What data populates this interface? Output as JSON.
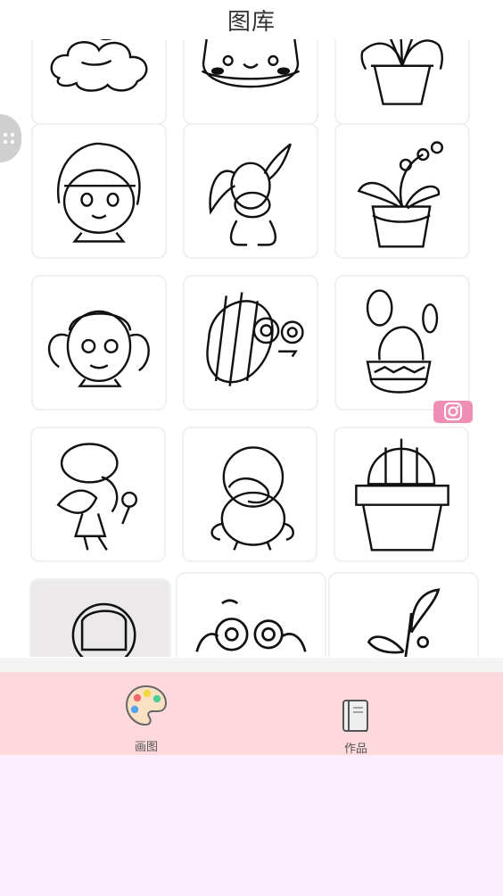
{
  "header": {
    "title": "图库"
  },
  "gallery": {
    "items": [
      {
        "name": "cloud",
        "icon": "cloud-drawing"
      },
      {
        "name": "fishbowl",
        "icon": "fishbowl-drawing"
      },
      {
        "name": "potted-grass",
        "icon": "potted-grass-drawing"
      },
      {
        "name": "girl-bob",
        "icon": "girl-bob-drawing"
      },
      {
        "name": "donkey",
        "icon": "donkey-drawing"
      },
      {
        "name": "orchid-pot",
        "icon": "orchid-drawing"
      },
      {
        "name": "girl-pigtails",
        "icon": "girl-pigtails-drawing"
      },
      {
        "name": "striped-fish",
        "icon": "fish-drawing"
      },
      {
        "name": "cactus-small",
        "icon": "cactus-drawing"
      },
      {
        "name": "beret-girl",
        "icon": "beret-girl-drawing"
      },
      {
        "name": "duck",
        "icon": "duck-drawing"
      },
      {
        "name": "cactus-big",
        "icon": "cactus-big-drawing"
      },
      {
        "name": "astronaut",
        "icon": "astronaut-drawing"
      },
      {
        "name": "frog",
        "icon": "frog-drawing"
      },
      {
        "name": "sprout",
        "icon": "sprout-drawing"
      }
    ]
  },
  "tabs": {
    "draw": {
      "label": "画图",
      "icon": "palette-icon"
    },
    "works": {
      "label": "作品",
      "icon": "book-icon"
    }
  },
  "colors": {
    "tabbar_bg": "#fdd9de",
    "bottom_bg": "#fdeefe",
    "badge": "#ef8fb6",
    "float_button": "#cfcfcf"
  }
}
